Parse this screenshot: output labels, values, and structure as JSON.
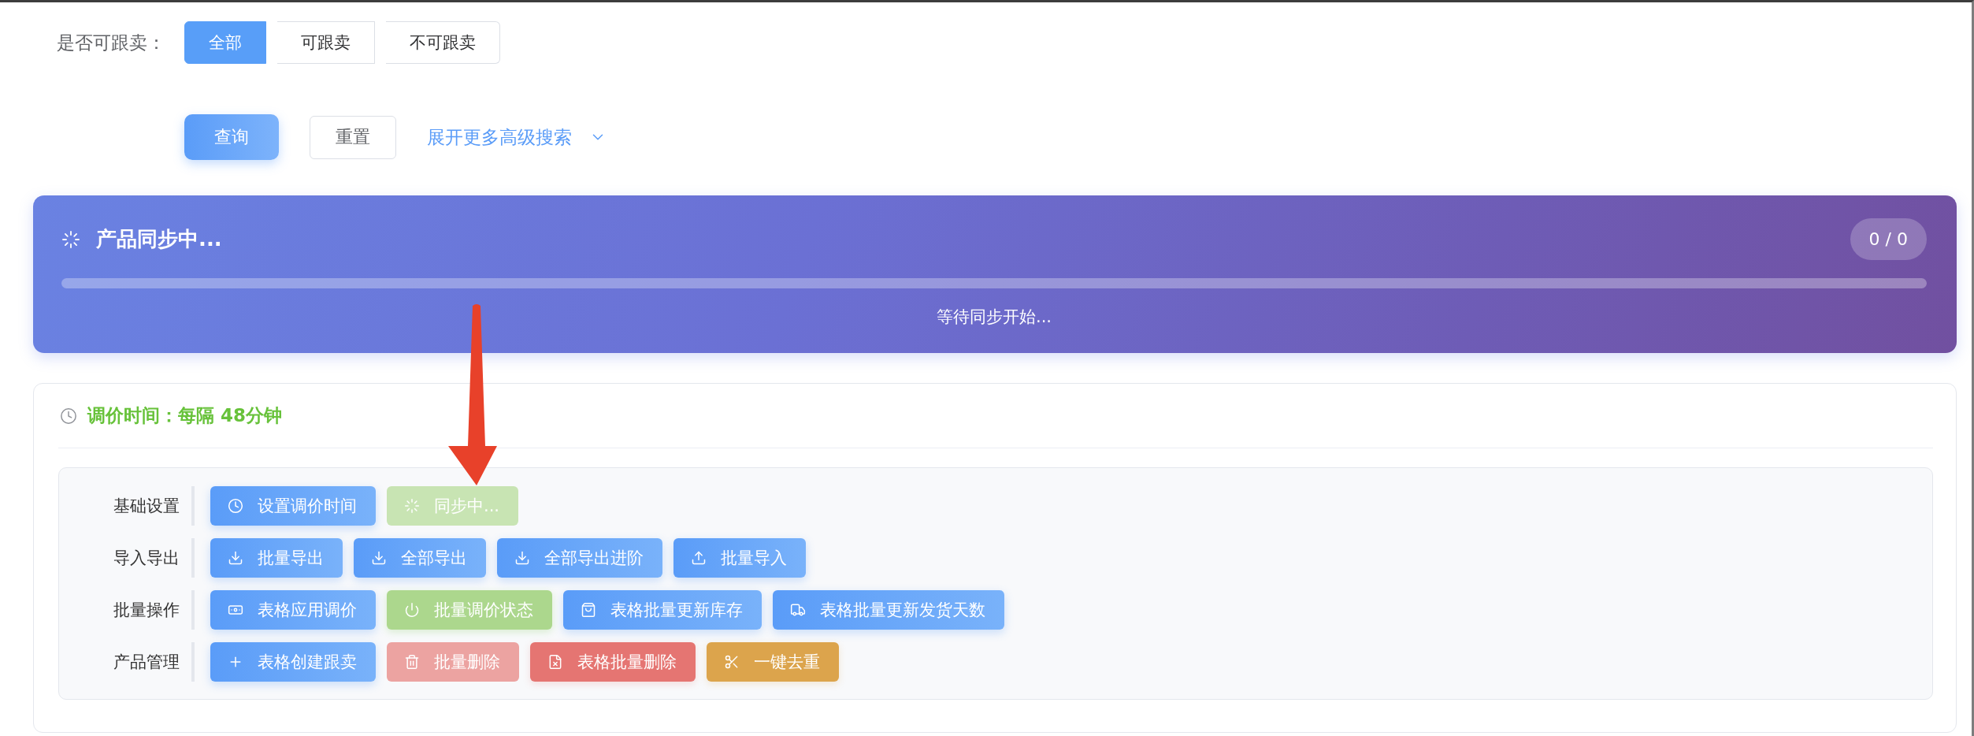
{
  "filter": {
    "label": "是否可跟卖：",
    "options": [
      {
        "label": "全部",
        "selected": true
      },
      {
        "label": "可跟卖",
        "selected": false
      },
      {
        "label": "不可跟卖",
        "selected": false
      }
    ]
  },
  "actions": [
    {
      "label": "查询",
      "kind": "primary"
    },
    {
      "label": "重置",
      "kind": "default"
    }
  ],
  "advanced_search": {
    "label": "展开更多高级搜索",
    "expanded": false
  },
  "sync": {
    "title": "产品同步中...",
    "count": "0 / 0",
    "level": 0,
    "status": "等待同步开始..."
  },
  "schedule": {
    "text": "调价时间：每隔 48分钟"
  },
  "toolbar": {
    "groups": [
      {
        "label": "基础设置",
        "buttons": [
          {
            "label": "设置调价时间",
            "kind": "primary",
            "disabled": false
          },
          {
            "label": "同步中...",
            "kind": "success",
            "disabled": true
          }
        ]
      },
      {
        "label": "导入导出",
        "buttons": [
          {
            "label": "批量导出",
            "kind": "primary",
            "disabled": false
          },
          {
            "label": "全部导出",
            "kind": "primary",
            "disabled": false
          },
          {
            "label": "全部导出进阶",
            "kind": "primary",
            "disabled": false
          },
          {
            "label": "批量导入",
            "kind": "primary",
            "disabled": false
          }
        ]
      },
      {
        "label": "批量操作",
        "buttons": [
          {
            "label": "表格应用调价",
            "kind": "primary",
            "disabled": false
          },
          {
            "label": "批量调价状态",
            "kind": "success",
            "disabled": false
          },
          {
            "label": "表格批量更新库存",
            "kind": "primary",
            "disabled": false
          },
          {
            "label": "表格批量更新发货天数",
            "kind": "primary",
            "disabled": false
          }
        ]
      },
      {
        "label": "产品管理",
        "buttons": [
          {
            "label": "表格创建跟卖",
            "kind": "primary",
            "disabled": false
          },
          {
            "label": "批量删除",
            "kind": "danger",
            "disabled": true
          },
          {
            "label": "表格批量删除",
            "kind": "danger",
            "disabled": false
          },
          {
            "label": "一键去重",
            "kind": "warning",
            "disabled": false
          }
        ]
      }
    ]
  }
}
